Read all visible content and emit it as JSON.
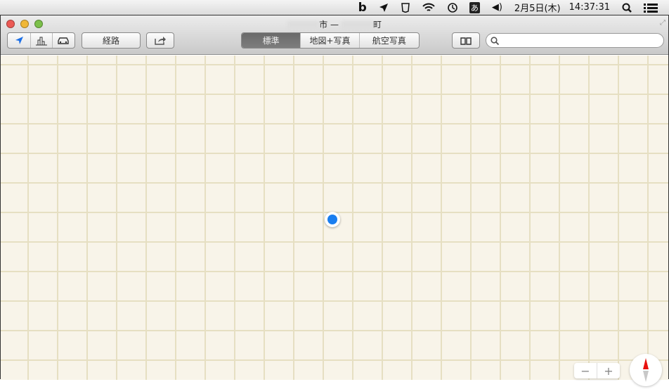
{
  "menubar": {
    "bold_b": "b",
    "ime": "あ",
    "datetime": "2月5日(木)",
    "clock": "14:37:31"
  },
  "window": {
    "title_city": "市",
    "title_sep": "—",
    "title_town": "町"
  },
  "toolbar": {
    "directions": "経路",
    "modes": [
      "標準",
      "地図+写真",
      "航空写真"
    ],
    "active_mode": "標準",
    "search_placeholder": "",
    "search_value": ""
  },
  "map": {
    "zoom_out": "−",
    "zoom_in": "+"
  }
}
